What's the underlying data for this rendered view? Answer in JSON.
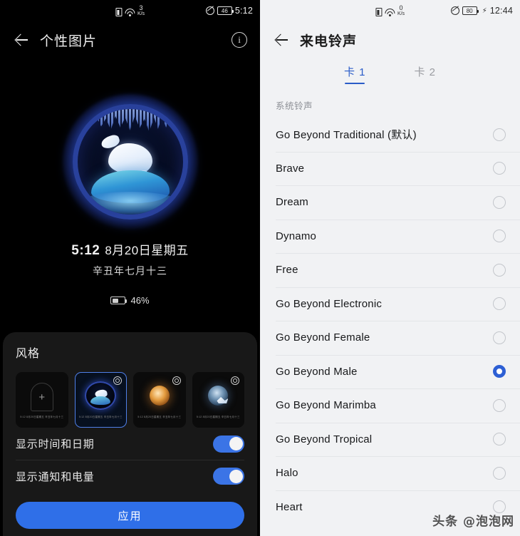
{
  "left_panel": {
    "status_bar": {
      "sim_icon": "sim-card-icon",
      "wifi_icon": "wifi-icon",
      "net_speed_value": "3",
      "net_speed_unit": "K/s",
      "mute_icon": "mute-icon",
      "battery_level": "46",
      "time": "5:12"
    },
    "app_bar": {
      "back_icon": "back-arrow-icon",
      "title": "个性图片",
      "info_icon": "info-icon",
      "info_glyph": "i"
    },
    "preview": {
      "artwork_name": "polar-bear-on-iceberg",
      "clock_time": "5:12",
      "clock_date": "8月20日星期五",
      "lunar_date": "辛丑年七月十三",
      "battery_text": "46%"
    },
    "sheet": {
      "title": "风格",
      "thumbnails": [
        {
          "name": "add-custom",
          "caption": "5:12 8月20日星期五\n辛丑年七月十三",
          "selected": false,
          "has_gear": false,
          "add_glyph": "+"
        },
        {
          "name": "polar-bear",
          "caption": "5:12 8月20日星期五\n辛丑年七月十三",
          "selected": true,
          "has_gear": true
        },
        {
          "name": "warm-globe",
          "caption": "5:12 8月20日星期五\n辛丑年七月十三",
          "selected": false,
          "has_gear": true
        },
        {
          "name": "cool-globe",
          "caption": "5:12 8月20日星期五\n辛丑年七月十三",
          "selected": false,
          "has_gear": true
        }
      ],
      "toggles": [
        {
          "label": "显示时间和日期",
          "on": true
        },
        {
          "label": "显示通知和电量",
          "on": true
        }
      ],
      "apply_label": "应用"
    }
  },
  "right_panel": {
    "status_bar": {
      "sim_icon": "sim-card-icon",
      "wifi_icon": "wifi-icon",
      "net_speed_value": "0",
      "net_speed_unit": "K/s",
      "mute_icon": "mute-icon",
      "battery_level": "80",
      "charging_glyph": "⚡",
      "time": "12:44"
    },
    "app_bar": {
      "back_icon": "back-arrow-icon",
      "title": "来电铃声"
    },
    "tabs": [
      {
        "label": "卡 1",
        "active": true
      },
      {
        "label": "卡 2",
        "active": false
      }
    ],
    "section_label": "系统铃声",
    "ringtones": [
      {
        "name": "Go Beyond Traditional (默认)",
        "selected": false
      },
      {
        "name": "Brave",
        "selected": false
      },
      {
        "name": "Dream",
        "selected": false
      },
      {
        "name": "Dynamo",
        "selected": false
      },
      {
        "name": "Free",
        "selected": false
      },
      {
        "name": "Go Beyond Electronic",
        "selected": false
      },
      {
        "name": "Go Beyond Female",
        "selected": false
      },
      {
        "name": "Go Beyond Male",
        "selected": true
      },
      {
        "name": "Go Beyond Marimba",
        "selected": false
      },
      {
        "name": "Go Beyond Tropical",
        "selected": false
      },
      {
        "name": "Halo",
        "selected": false
      },
      {
        "name": "Heart",
        "selected": false
      }
    ]
  },
  "watermark": "头条 @泡泡网",
  "colors": {
    "accent_blue": "#2f6fe8",
    "radio_blue": "#2d5fd4",
    "tab_blue": "#2a5cc8",
    "dark_bg": "#000000",
    "sheet_bg": "#181818",
    "light_bg": "#f1f2f4"
  }
}
